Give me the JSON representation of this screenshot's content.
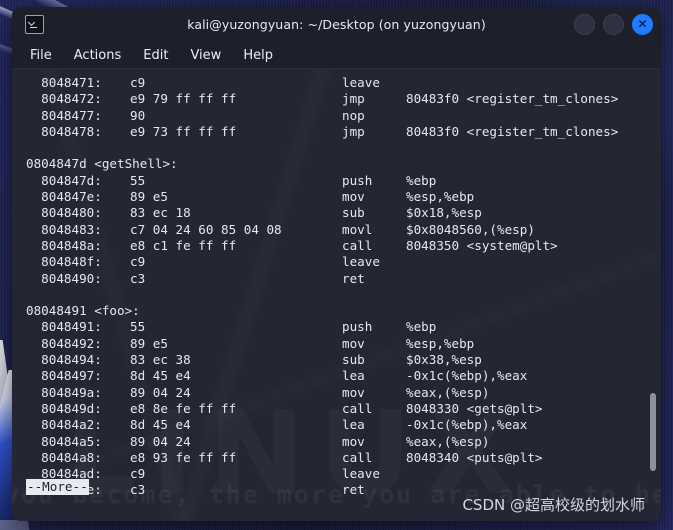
{
  "desktop": {
    "label": "desktop-wallpaper"
  },
  "window": {
    "title": "kali@yuzongyuan: ~/Desktop (on yuzongyuan)",
    "icon": "terminal-icon",
    "buttons": {
      "minimize": "",
      "maximize": "",
      "close": "✕"
    }
  },
  "menubar": {
    "items": [
      {
        "label": "File"
      },
      {
        "label": "Actions"
      },
      {
        "label": "Edit"
      },
      {
        "label": "View"
      },
      {
        "label": "Help"
      }
    ]
  },
  "terminal": {
    "background_color": "#242633",
    "foreground_color": "#e6e8f0",
    "watermark_linux": "LINUX",
    "watermark_quote": "you become, the more you are able to hear",
    "more_prompt": "--More--",
    "lines": [
      {
        "type": "insn",
        "addr": "8048471:",
        "bytes": "c9",
        "mnem": "leave",
        "ops": ""
      },
      {
        "type": "insn",
        "addr": "8048472:",
        "bytes": "e9 79 ff ff ff",
        "mnem": "jmp",
        "ops": "80483f0 <register_tm_clones>"
      },
      {
        "type": "insn",
        "addr": "8048477:",
        "bytes": "90",
        "mnem": "nop",
        "ops": ""
      },
      {
        "type": "insn",
        "addr": "8048478:",
        "bytes": "e9 73 ff ff ff",
        "mnem": "jmp",
        "ops": "80483f0 <register_tm_clones>"
      },
      {
        "type": "blank"
      },
      {
        "type": "header",
        "text": "0804847d <getShell>:"
      },
      {
        "type": "insn",
        "addr": "804847d:",
        "bytes": "55",
        "mnem": "push",
        "ops": "%ebp"
      },
      {
        "type": "insn",
        "addr": "804847e:",
        "bytes": "89 e5",
        "mnem": "mov",
        "ops": "%esp,%ebp"
      },
      {
        "type": "insn",
        "addr": "8048480:",
        "bytes": "83 ec 18",
        "mnem": "sub",
        "ops": "$0x18,%esp"
      },
      {
        "type": "insn",
        "addr": "8048483:",
        "bytes": "c7 04 24 60 85 04 08",
        "mnem": "movl",
        "ops": "$0x8048560,(%esp)"
      },
      {
        "type": "insn",
        "addr": "804848a:",
        "bytes": "e8 c1 fe ff ff",
        "mnem": "call",
        "ops": "8048350 <system@plt>"
      },
      {
        "type": "insn",
        "addr": "804848f:",
        "bytes": "c9",
        "mnem": "leave",
        "ops": ""
      },
      {
        "type": "insn",
        "addr": "8048490:",
        "bytes": "c3",
        "mnem": "ret",
        "ops": ""
      },
      {
        "type": "blank"
      },
      {
        "type": "header",
        "text": "08048491 <foo>:"
      },
      {
        "type": "insn",
        "addr": "8048491:",
        "bytes": "55",
        "mnem": "push",
        "ops": "%ebp"
      },
      {
        "type": "insn",
        "addr": "8048492:",
        "bytes": "89 e5",
        "mnem": "mov",
        "ops": "%esp,%ebp"
      },
      {
        "type": "insn",
        "addr": "8048494:",
        "bytes": "83 ec 38",
        "mnem": "sub",
        "ops": "$0x38,%esp"
      },
      {
        "type": "insn",
        "addr": "8048497:",
        "bytes": "8d 45 e4",
        "mnem": "lea",
        "ops": "-0x1c(%ebp),%eax"
      },
      {
        "type": "insn",
        "addr": "804849a:",
        "bytes": "89 04 24",
        "mnem": "mov",
        "ops": "%eax,(%esp)"
      },
      {
        "type": "insn",
        "addr": "804849d:",
        "bytes": "e8 8e fe ff ff",
        "mnem": "call",
        "ops": "8048330 <gets@plt>"
      },
      {
        "type": "insn",
        "addr": "80484a2:",
        "bytes": "8d 45 e4",
        "mnem": "lea",
        "ops": "-0x1c(%ebp),%eax"
      },
      {
        "type": "insn",
        "addr": "80484a5:",
        "bytes": "89 04 24",
        "mnem": "mov",
        "ops": "%eax,(%esp)"
      },
      {
        "type": "insn",
        "addr": "80484a8:",
        "bytes": "e8 93 fe ff ff",
        "mnem": "call",
        "ops": "8048340 <puts@plt>"
      },
      {
        "type": "insn",
        "addr": "80484ad:",
        "bytes": "c9",
        "mnem": "leave",
        "ops": ""
      },
      {
        "type": "insn",
        "addr": "80484ae:",
        "bytes": "c3",
        "mnem": "ret",
        "ops": ""
      }
    ]
  },
  "scrollbar": {
    "name": "vertical-scrollbar"
  },
  "watermark": {
    "csdn": "CSDN @超高校级的划水师"
  }
}
